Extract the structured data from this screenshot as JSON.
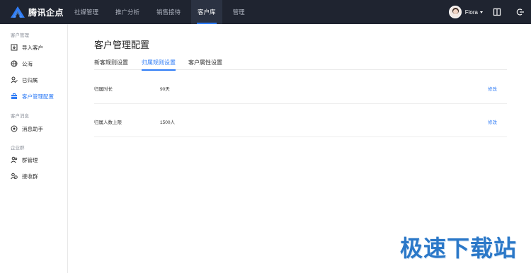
{
  "app": {
    "name": "腾讯企点",
    "brand_color": "#2f7cf6",
    "topbar_color": "#1f2430"
  },
  "nav": {
    "items": [
      {
        "label": "社媒管理"
      },
      {
        "label": "推广分析"
      },
      {
        "label": "销售接待"
      },
      {
        "label": "客户库",
        "active": true
      },
      {
        "label": "管理"
      }
    ]
  },
  "user": {
    "name": "Flora"
  },
  "topbar_icons": {
    "book": "book-icon",
    "logout": "logout-icon"
  },
  "sidebar": {
    "groups": [
      {
        "title": "客户管理",
        "items": [
          {
            "label": "导入客户",
            "icon": "import-icon"
          },
          {
            "label": "公海",
            "icon": "globe-icon"
          },
          {
            "label": "已归属",
            "icon": "user-check-icon"
          },
          {
            "label": "客户管理配置",
            "icon": "briefcase-icon",
            "active": true
          }
        ]
      },
      {
        "title": "客户消息",
        "items": [
          {
            "label": "消息助手",
            "icon": "message-target-icon"
          }
        ]
      },
      {
        "title": "企业群",
        "items": [
          {
            "label": "群管理",
            "icon": "group-icon"
          },
          {
            "label": "接收群",
            "icon": "group-receive-icon"
          }
        ]
      }
    ]
  },
  "main": {
    "title": "客户管理配置",
    "tabs": [
      {
        "label": "新客规则设置"
      },
      {
        "label": "归属规则设置",
        "active": true
      },
      {
        "label": "客户属性设置"
      }
    ],
    "rows": [
      {
        "label": "归属时长",
        "value": "90天",
        "action": "修改"
      },
      {
        "label": "归属人数上限",
        "value": "1500人",
        "action": "修改"
      }
    ]
  },
  "watermark": "极速下载站"
}
